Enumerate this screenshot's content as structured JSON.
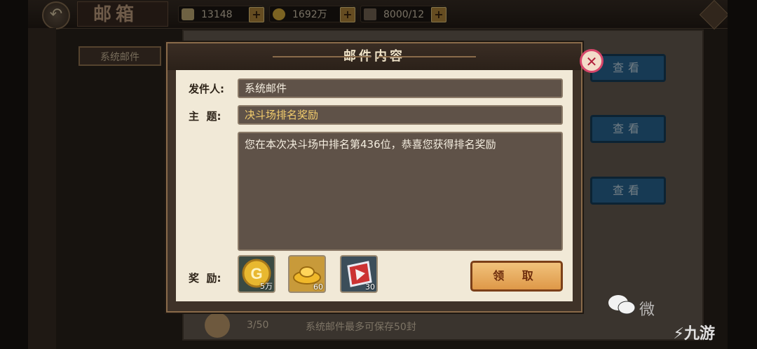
{
  "header": {
    "title": "邮箱",
    "resources": [
      {
        "name": "silver-ingot",
        "value": "13148"
      },
      {
        "name": "gold-coin",
        "value": "1692万"
      },
      {
        "name": "army",
        "value": "8000/12"
      }
    ]
  },
  "sidebar": {
    "tab_label": "系统邮件"
  },
  "mail_list": {
    "view_labels": [
      "查看",
      "查看",
      "查看"
    ],
    "count": "3/50",
    "note": "系统邮件最多可保存50封"
  },
  "dialog": {
    "title": "邮件内容",
    "sender_label": "发件人:",
    "sender": "系统邮件",
    "subject_label": "主  题:",
    "subject": "决斗场排名奖励",
    "content": "您在本次决斗场中排名第436位，恭喜您获得排名奖励",
    "reward_label": "奖  励:",
    "rewards": [
      {
        "icon": "gold-coin-icon",
        "count": "5万"
      },
      {
        "icon": "gold-ingot-icon",
        "count": "60"
      },
      {
        "icon": "red-token-icon",
        "count": "30"
      }
    ],
    "claim_label": "领 取"
  },
  "watermark": {
    "wechat_text": "微",
    "brand": "九游"
  },
  "colors": {
    "accent": "#de9848",
    "subject": "#f2cc6c",
    "view_button": "#2b6a9a"
  }
}
